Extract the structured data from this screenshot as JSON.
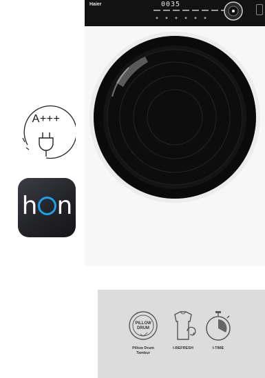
{
  "machine": {
    "brand": "Haier",
    "display_time": "0035"
  },
  "energy_badge": {
    "rating": "A+++",
    "icon": "plug-icon"
  },
  "app_icon": {
    "label_h": "h",
    "label_n": "n"
  },
  "features": [
    {
      "icon": "pillow-drum-icon",
      "badge_line1": "PILLOW",
      "badge_line2": "DRUM",
      "label_line1": "Pillow Drum",
      "label_line2": "Tambur"
    },
    {
      "icon": "shirt-refresh-icon",
      "label_line1": "I-REFRESH",
      "label_line2": ""
    },
    {
      "icon": "stopwatch-icon",
      "label_line1": "I-TIME",
      "label_line2": ""
    }
  ],
  "colors": {
    "hon_accent": "#18a3ea",
    "panel": "#121212",
    "door_ring": "#0a0a0a"
  }
}
